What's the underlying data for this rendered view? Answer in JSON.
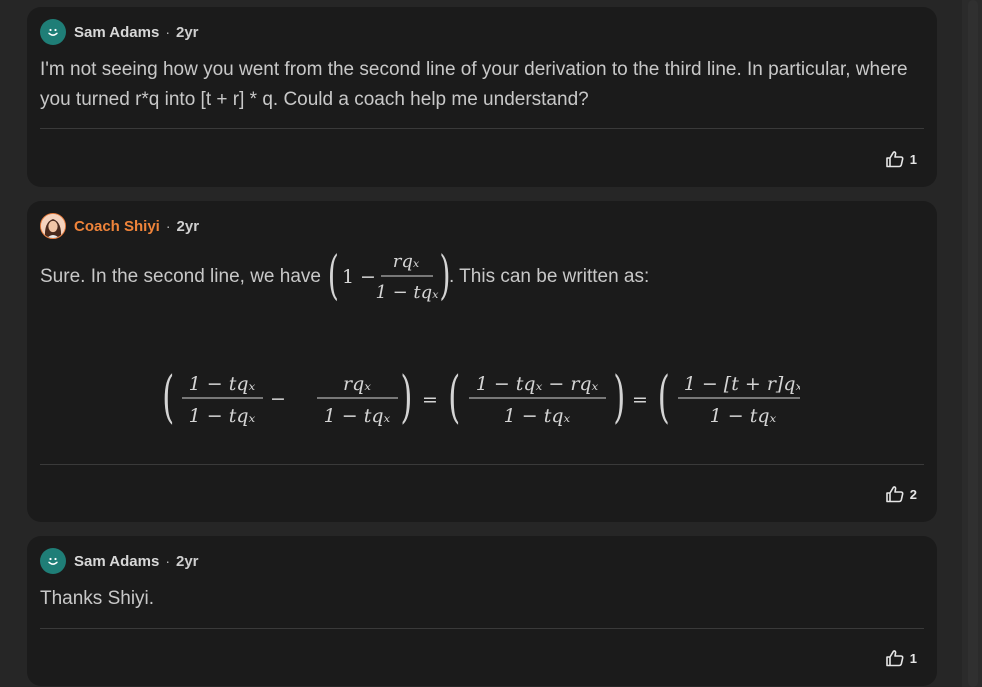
{
  "comments": [
    {
      "author": "Sam Adams",
      "time": "2yr",
      "text": "I'm not seeing how you went from the second line of your derivation to the third line. In particular, where you turned r*q into [t + r] * q. Could a coach help me understand?",
      "likes": "1"
    },
    {
      "author": "Coach Shiyi",
      "time": "2yr",
      "text_before": "Sure. In the second line, we have",
      "text_after": ". This can be written as:",
      "likes": "2",
      "math": {
        "one": "1",
        "minus": "−",
        "equals": "=",
        "rqx": "rqₓ",
        "one_minus_tqx": "1 − tqₓ",
        "one_minus_tqx_minus_rqx": "1 − tqₓ − rqₓ",
        "one_minus_bracket": "1 − [t + r]qₓ",
        "lparen": "(",
        "rparen": ")"
      }
    },
    {
      "author": "Sam Adams",
      "time": "2yr",
      "text": "Thanks Shiyi.",
      "likes": "1"
    }
  ],
  "separator": "·",
  "icons": {
    "avatar_user": "smiley-icon",
    "avatar_coach": "coach-portrait-icon",
    "like": "thumbs-up-icon"
  },
  "colors": {
    "coach_name": "#f0843a",
    "avatar_bg": "#1f7e77",
    "card_bg": "#1b1b1b",
    "page_bg": "#262626"
  }
}
